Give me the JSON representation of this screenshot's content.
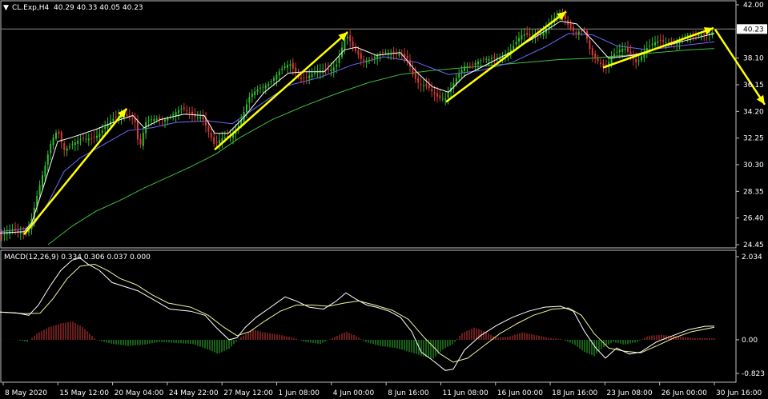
{
  "chart_data": [
    {
      "type": "candlestick",
      "symbol_label": "CL.Exp,H4",
      "ohlc_label": "40.29 40.33 40.05 40.23",
      "price_axis_labels": [
        "42.00",
        "40.23",
        "38.10",
        "36.15",
        "34.20",
        "32.25",
        "30.30",
        "28.35",
        "26.40",
        "24.45"
      ],
      "price_ticks": [
        42.0,
        38.1,
        36.15,
        34.2,
        32.25,
        30.3,
        28.35,
        26.4,
        24.45
      ],
      "ylim": [
        24.45,
        42.0
      ],
      "last_price": 40.23,
      "last_price_label": "40.23",
      "time_labels": [
        "8 May 2020",
        "15 May 12:00",
        "20 May 04:00",
        "24 May 22:00",
        "27 May 12:00",
        "1 Jun 08:00",
        "4 Jun 00:00",
        "8 Jun 16:00",
        "11 Jun 08:00",
        "16 Jun 00:00",
        "18 Jun 16:00",
        "23 Jun 08:00",
        "26 Jun 00:00",
        "30 Jun 16:00"
      ],
      "close_path": [
        [
          0,
          25.1
        ],
        [
          18,
          25.3
        ],
        [
          32,
          25.4
        ],
        [
          38,
          26.2
        ],
        [
          47,
          28.2
        ],
        [
          56,
          29.9
        ],
        [
          64,
          31.9
        ],
        [
          72,
          33.0
        ],
        [
          80,
          31.6
        ],
        [
          95,
          31.8
        ],
        [
          110,
          32.2
        ],
        [
          125,
          32.8
        ],
        [
          138,
          33.3
        ],
        [
          150,
          33.8
        ],
        [
          160,
          34.1
        ],
        [
          168,
          33.8
        ],
        [
          174,
          31.4
        ],
        [
          182,
          33.2
        ],
        [
          196,
          33.7
        ],
        [
          212,
          33.9
        ],
        [
          228,
          34.2
        ],
        [
          242,
          34.0
        ],
        [
          252,
          34.0
        ],
        [
          262,
          32.4
        ],
        [
          268,
          31.5
        ],
        [
          278,
          32.2
        ],
        [
          290,
          32.7
        ],
        [
          300,
          33.4
        ],
        [
          312,
          35.1
        ],
        [
          326,
          36.1
        ],
        [
          340,
          36.6
        ],
        [
          352,
          37.1
        ],
        [
          362,
          37.6
        ],
        [
          375,
          36.8
        ],
        [
          392,
          36.8
        ],
        [
          408,
          37.2
        ],
        [
          420,
          37.8
        ],
        [
          432,
          39.7
        ],
        [
          442,
          38.6
        ],
        [
          452,
          38.0
        ],
        [
          466,
          38.3
        ],
        [
          486,
          38.3
        ],
        [
          500,
          38.6
        ],
        [
          508,
          38.3
        ],
        [
          516,
          36.7
        ],
        [
          524,
          35.9
        ],
        [
          535,
          36.0
        ],
        [
          546,
          35.5
        ],
        [
          556,
          35.1
        ],
        [
          566,
          36.0
        ],
        [
          580,
          37.6
        ],
        [
          594,
          37.9
        ],
        [
          610,
          37.8
        ],
        [
          625,
          38.3
        ],
        [
          640,
          38.9
        ],
        [
          652,
          39.6
        ],
        [
          664,
          39.8
        ],
        [
          678,
          40.1
        ],
        [
          692,
          40.8
        ],
        [
          703,
          41.3
        ],
        [
          710,
          40.6
        ],
        [
          718,
          40.2
        ],
        [
          730,
          40.0
        ],
        [
          738,
          38.2
        ],
        [
          746,
          37.9
        ],
        [
          756,
          37.6
        ],
        [
          764,
          38.4
        ],
        [
          780,
          38.6
        ],
        [
          795,
          37.9
        ],
        [
          806,
          38.9
        ],
        [
          820,
          39.1
        ],
        [
          836,
          39.3
        ],
        [
          852,
          39.6
        ],
        [
          868,
          39.6
        ],
        [
          880,
          40.0
        ],
        [
          892,
          40.23
        ]
      ],
      "ma_fast_path": [
        [
          0,
          25.3
        ],
        [
          30,
          25.4
        ],
        [
          40,
          26.1
        ],
        [
          56,
          29.0
        ],
        [
          72,
          32.0
        ],
        [
          90,
          32.3
        ],
        [
          120,
          32.9
        ],
        [
          150,
          33.6
        ],
        [
          166,
          33.9
        ],
        [
          180,
          33.0
        ],
        [
          200,
          33.6
        ],
        [
          230,
          34.0
        ],
        [
          255,
          33.9
        ],
        [
          268,
          32.6
        ],
        [
          285,
          32.6
        ],
        [
          305,
          33.8
        ],
        [
          330,
          35.6
        ],
        [
          360,
          37.0
        ],
        [
          380,
          37.1
        ],
        [
          405,
          37.1
        ],
        [
          430,
          38.7
        ],
        [
          445,
          38.9
        ],
        [
          470,
          38.3
        ],
        [
          500,
          38.5
        ],
        [
          520,
          37.1
        ],
        [
          540,
          36.0
        ],
        [
          560,
          35.6
        ],
        [
          580,
          36.8
        ],
        [
          610,
          37.7
        ],
        [
          640,
          38.6
        ],
        [
          670,
          39.7
        ],
        [
          700,
          40.8
        ],
        [
          720,
          40.6
        ],
        [
          740,
          39.4
        ],
        [
          760,
          38.1
        ],
        [
          790,
          38.3
        ],
        [
          820,
          38.8
        ],
        [
          850,
          39.3
        ],
        [
          892,
          39.9
        ]
      ],
      "ma_mid_path": [
        [
          0,
          25.4
        ],
        [
          40,
          25.7
        ],
        [
          60,
          27.5
        ],
        [
          80,
          29.8
        ],
        [
          100,
          30.8
        ],
        [
          130,
          31.8
        ],
        [
          160,
          32.8
        ],
        [
          190,
          33.0
        ],
        [
          220,
          33.4
        ],
        [
          260,
          33.5
        ],
        [
          290,
          33.3
        ],
        [
          320,
          34.5
        ],
        [
          360,
          36.1
        ],
        [
          400,
          36.7
        ],
        [
          440,
          37.6
        ],
        [
          480,
          38.2
        ],
        [
          520,
          37.8
        ],
        [
          560,
          36.9
        ],
        [
          600,
          37.2
        ],
        [
          640,
          37.8
        ],
        [
          680,
          38.9
        ],
        [
          710,
          39.9
        ],
        [
          740,
          39.8
        ],
        [
          770,
          39.0
        ],
        [
          810,
          38.7
        ],
        [
          850,
          39.0
        ],
        [
          892,
          39.3
        ]
      ],
      "ma_slow_path": [
        [
          60,
          24.45
        ],
        [
          90,
          25.8
        ],
        [
          120,
          26.9
        ],
        [
          150,
          27.7
        ],
        [
          180,
          28.6
        ],
        [
          210,
          29.4
        ],
        [
          240,
          30.2
        ],
        [
          270,
          31.1
        ],
        [
          300,
          32.3
        ],
        [
          340,
          33.6
        ],
        [
          380,
          34.6
        ],
        [
          420,
          35.5
        ],
        [
          460,
          36.3
        ],
        [
          500,
          36.9
        ],
        [
          540,
          37.2
        ],
        [
          580,
          37.4
        ],
        [
          620,
          37.6
        ],
        [
          660,
          37.8
        ],
        [
          700,
          38.0
        ],
        [
          740,
          38.1
        ],
        [
          780,
          38.3
        ],
        [
          820,
          38.5
        ],
        [
          860,
          38.7
        ],
        [
          892,
          38.8
        ]
      ],
      "arrows": [
        {
          "from": [
            30,
            25.2
          ],
          "to": [
            158,
            34.4
          ]
        },
        {
          "from": [
            268,
            31.4
          ],
          "to": [
            434,
            40.0
          ]
        },
        {
          "from": [
            557,
            34.9
          ],
          "to": [
            707,
            41.5
          ]
        },
        {
          "from": [
            753,
            37.4
          ],
          "to": [
            891,
            40.3
          ]
        },
        {
          "from": [
            893,
            40.2
          ],
          "to": [
            955,
            34.7
          ]
        }
      ]
    },
    {
      "type": "macd",
      "indicator_label": "MACD(12,26,9) 0.334 0.306 0.037 0.000",
      "axis_labels": [
        "2.034",
        "0.00",
        "-0.823"
      ],
      "ylim": [
        -0.823,
        2.034
      ],
      "macd_path": [
        [
          0,
          0.68
        ],
        [
          20,
          0.66
        ],
        [
          36,
          0.6
        ],
        [
          48,
          0.85
        ],
        [
          62,
          1.3
        ],
        [
          76,
          1.7
        ],
        [
          90,
          1.95
        ],
        [
          100,
          2.0
        ],
        [
          110,
          1.85
        ],
        [
          124,
          1.7
        ],
        [
          140,
          1.4
        ],
        [
          156,
          1.3
        ],
        [
          172,
          1.2
        ],
        [
          190,
          1.0
        ],
        [
          212,
          0.75
        ],
        [
          238,
          0.7
        ],
        [
          256,
          0.6
        ],
        [
          270,
          0.3
        ],
        [
          286,
          0.0
        ],
        [
          296,
          0.05
        ],
        [
          306,
          0.3
        ],
        [
          320,
          0.55
        ],
        [
          338,
          0.8
        ],
        [
          356,
          1.05
        ],
        [
          370,
          0.95
        ],
        [
          386,
          0.8
        ],
        [
          404,
          0.75
        ],
        [
          420,
          0.95
        ],
        [
          432,
          1.15
        ],
        [
          444,
          1.0
        ],
        [
          458,
          0.85
        ],
        [
          470,
          0.8
        ],
        [
          486,
          0.7
        ],
        [
          500,
          0.55
        ],
        [
          514,
          0.2
        ],
        [
          526,
          -0.3
        ],
        [
          540,
          -0.5
        ],
        [
          556,
          -0.75
        ],
        [
          566,
          -0.72
        ],
        [
          580,
          -0.25
        ],
        [
          600,
          0.1
        ],
        [
          620,
          0.35
        ],
        [
          640,
          0.55
        ],
        [
          660,
          0.7
        ],
        [
          680,
          0.8
        ],
        [
          700,
          0.82
        ],
        [
          716,
          0.7
        ],
        [
          730,
          0.2
        ],
        [
          744,
          -0.2
        ],
        [
          756,
          -0.45
        ],
        [
          770,
          -0.2
        ],
        [
          786,
          -0.35
        ],
        [
          800,
          -0.3
        ],
        [
          820,
          -0.05
        ],
        [
          840,
          0.1
        ],
        [
          860,
          0.25
        ],
        [
          880,
          0.33
        ],
        [
          892,
          0.334
        ]
      ],
      "signal_path": [
        [
          0,
          0.68
        ],
        [
          30,
          0.64
        ],
        [
          50,
          0.65
        ],
        [
          66,
          1.0
        ],
        [
          84,
          1.5
        ],
        [
          100,
          1.8
        ],
        [
          118,
          1.85
        ],
        [
          134,
          1.7
        ],
        [
          150,
          1.5
        ],
        [
          170,
          1.35
        ],
        [
          190,
          1.1
        ],
        [
          210,
          0.9
        ],
        [
          238,
          0.8
        ],
        [
          260,
          0.6
        ],
        [
          280,
          0.3
        ],
        [
          296,
          0.1
        ],
        [
          312,
          0.2
        ],
        [
          330,
          0.45
        ],
        [
          350,
          0.7
        ],
        [
          370,
          0.85
        ],
        [
          390,
          0.85
        ],
        [
          410,
          0.82
        ],
        [
          430,
          0.9
        ],
        [
          448,
          0.95
        ],
        [
          468,
          0.85
        ],
        [
          490,
          0.72
        ],
        [
          510,
          0.5
        ],
        [
          530,
          0.05
        ],
        [
          550,
          -0.35
        ],
        [
          566,
          -0.55
        ],
        [
          584,
          -0.45
        ],
        [
          604,
          -0.15
        ],
        [
          624,
          0.15
        ],
        [
          646,
          0.4
        ],
        [
          666,
          0.6
        ],
        [
          690,
          0.75
        ],
        [
          710,
          0.78
        ],
        [
          726,
          0.6
        ],
        [
          742,
          0.15
        ],
        [
          760,
          -0.2
        ],
        [
          780,
          -0.28
        ],
        [
          800,
          -0.32
        ],
        [
          820,
          -0.15
        ],
        [
          842,
          0.05
        ],
        [
          864,
          0.2
        ],
        [
          892,
          0.306
        ]
      ],
      "hist_envelope": [
        [
          0,
          0.0
        ],
        [
          20,
          0.0
        ],
        [
          34,
          -0.05
        ],
        [
          46,
          0.15
        ],
        [
          60,
          0.3
        ],
        [
          76,
          0.4
        ],
        [
          90,
          0.45
        ],
        [
          104,
          0.3
        ],
        [
          120,
          0.0
        ],
        [
          140,
          -0.1
        ],
        [
          160,
          -0.15
        ],
        [
          180,
          -0.12
        ],
        [
          200,
          -0.05
        ],
        [
          220,
          -0.08
        ],
        [
          240,
          -0.1
        ],
        [
          262,
          -0.25
        ],
        [
          272,
          -0.35
        ],
        [
          286,
          -0.22
        ],
        [
          300,
          0.05
        ],
        [
          316,
          0.25
        ],
        [
          330,
          0.18
        ],
        [
          350,
          0.12
        ],
        [
          366,
          0.05
        ],
        [
          380,
          -0.05
        ],
        [
          400,
          -0.1
        ],
        [
          416,
          0.05
        ],
        [
          432,
          0.2
        ],
        [
          444,
          0.1
        ],
        [
          456,
          -0.05
        ],
        [
          474,
          -0.15
        ],
        [
          494,
          -0.2
        ],
        [
          512,
          -0.3
        ],
        [
          528,
          -0.4
        ],
        [
          540,
          -0.48
        ],
        [
          552,
          -0.25
        ],
        [
          566,
          -0.1
        ],
        [
          576,
          0.15
        ],
        [
          592,
          0.3
        ],
        [
          606,
          0.2
        ],
        [
          620,
          0.05
        ],
        [
          636,
          0.08
        ],
        [
          652,
          0.18
        ],
        [
          668,
          0.12
        ],
        [
          684,
          0.05
        ],
        [
          700,
          0.02
        ],
        [
          716,
          -0.1
        ],
        [
          730,
          -0.3
        ],
        [
          742,
          -0.4
        ],
        [
          752,
          -0.2
        ],
        [
          766,
          -0.05
        ],
        [
          780,
          -0.12
        ],
        [
          796,
          -0.05
        ],
        [
          810,
          0.1
        ],
        [
          826,
          0.12
        ],
        [
          846,
          0.08
        ],
        [
          868,
          0.04
        ],
        [
          892,
          0.037
        ]
      ]
    }
  ],
  "colors": {
    "background": "#000000",
    "bull_candle": "#2ebd2e",
    "bear_candle": "#d63a3a",
    "ma_fast": "#ffffff",
    "ma_mid": "#6a6aff",
    "ma_slow": "#3fbf3f",
    "arrow": "#ffff00",
    "macd_line": "#ffffff",
    "signal_line": "#f2f29a",
    "hist_up": "#d63a3a",
    "hist_down": "#2ebd2e",
    "last_price_line": "#8c8c8c",
    "grid_frame": "#c0c0c0"
  }
}
